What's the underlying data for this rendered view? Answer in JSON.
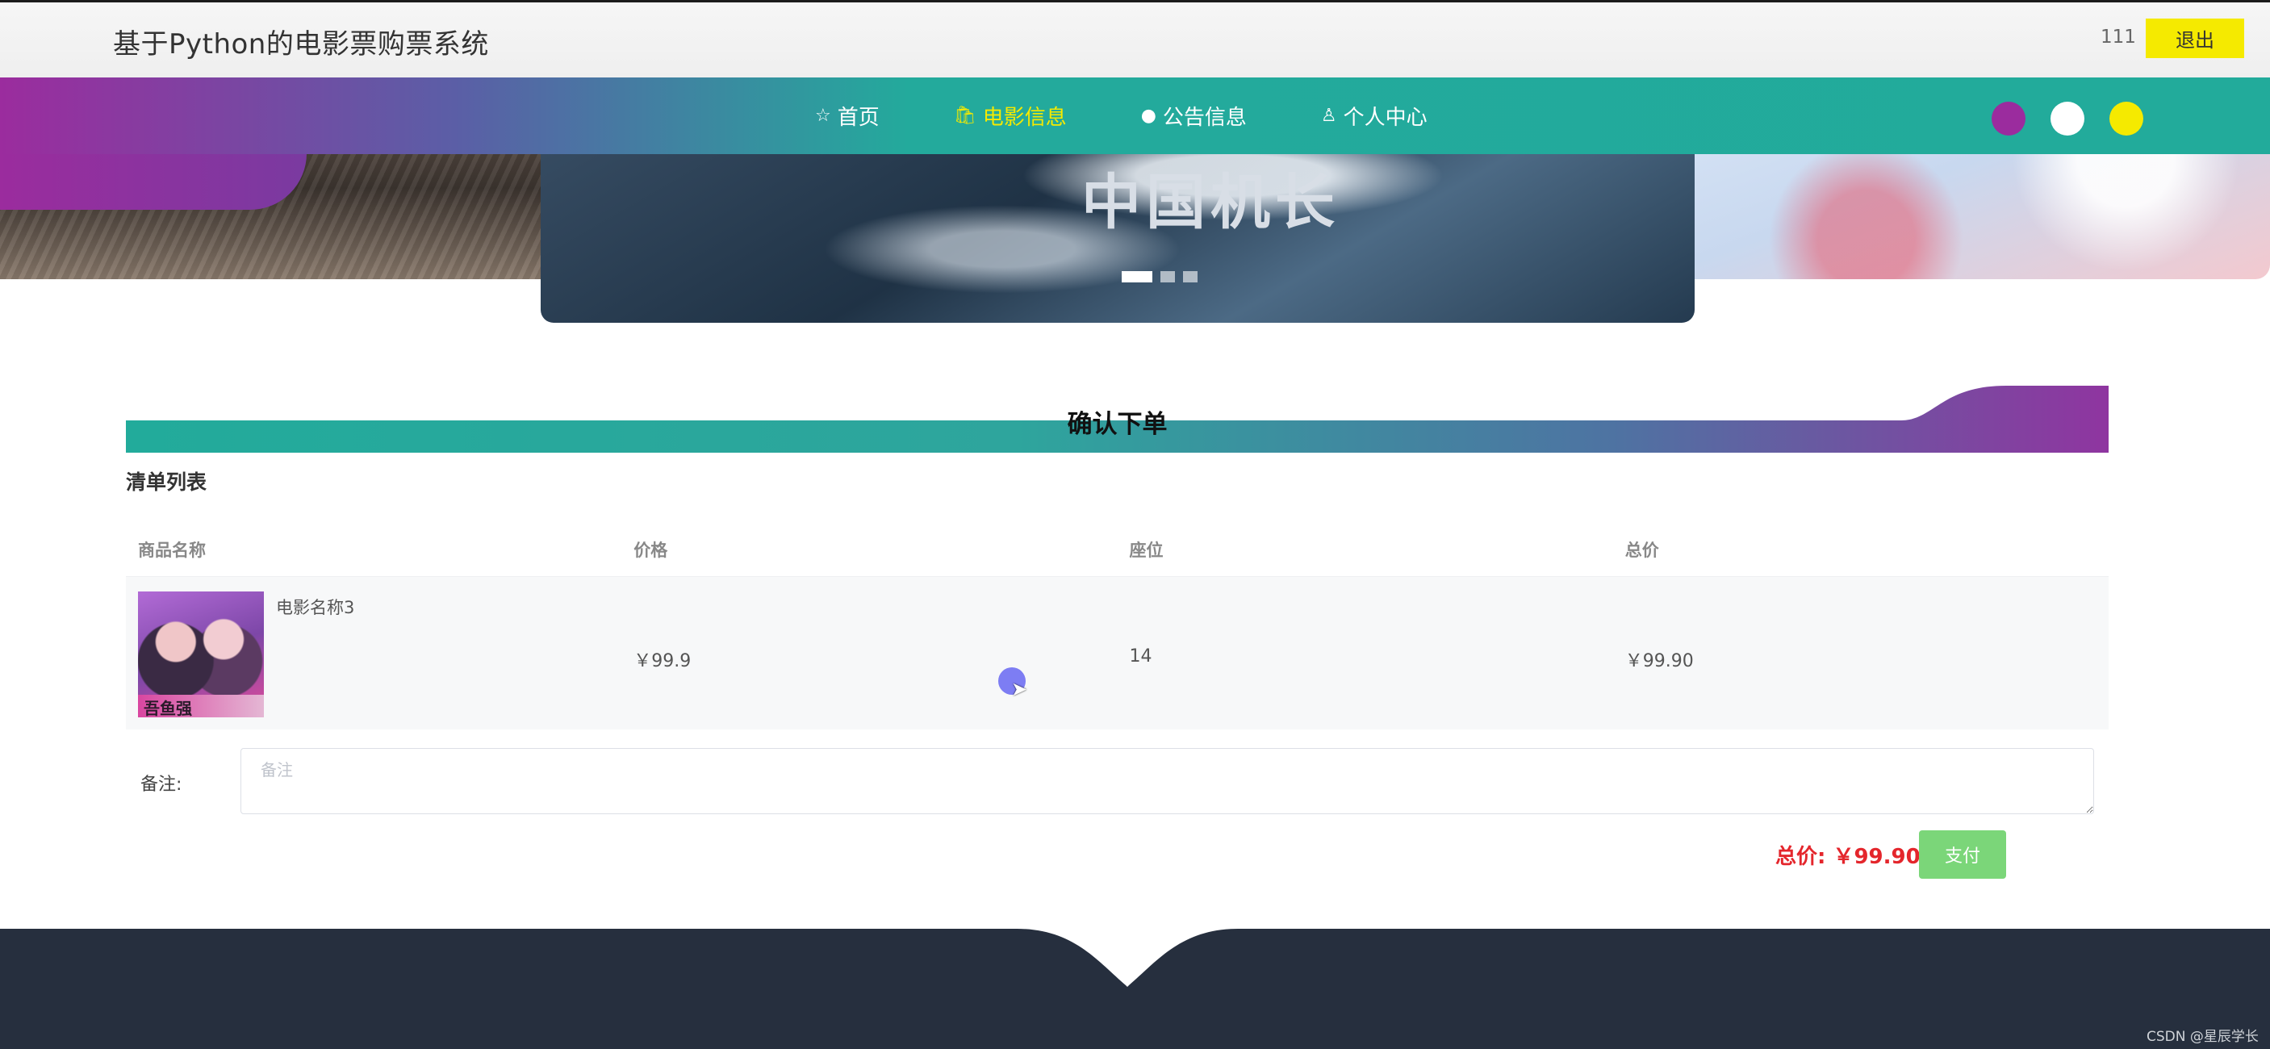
{
  "header": {
    "site_title": "基于Python的电影票购票系统",
    "username": "111",
    "logout_label": "退出"
  },
  "banner": {
    "caption": "中国机长",
    "slide_count": 3,
    "active_slide": 1
  },
  "nav": {
    "items": [
      {
        "label": "首页",
        "icon": "star-icon",
        "active": false
      },
      {
        "label": "电影信息",
        "icon": "bag-icon",
        "active": true
      },
      {
        "label": "公告信息",
        "icon": "info-icon",
        "active": false
      },
      {
        "label": "个人中心",
        "icon": "user-icon",
        "active": false
      }
    ],
    "theme_colors": [
      "#9b2c9e",
      "#ffffff",
      "#f5ea00"
    ]
  },
  "order": {
    "section_title": "确认下单",
    "list_title": "清单列表",
    "columns": [
      "商品名称",
      "价格",
      "座位",
      "总价"
    ],
    "rows": [
      {
        "name": "电影名称3",
        "price": "￥99.9",
        "seat": "14",
        "total": "￥99.90",
        "poster_text": "吾鱼强"
      }
    ],
    "remark_label": "备注:",
    "remark_placeholder": "备注",
    "remark_value": "",
    "total_text": "总价: ￥99.90",
    "pay_label": "支付"
  },
  "colors": {
    "accent": "#22ab9b",
    "brand_purple": "#9b2c9e",
    "logout_yellow": "#f5ea00",
    "total_red": "#e4262c",
    "pay_green": "#7bd679",
    "footer_dark": "#262f3e"
  },
  "watermark": "CSDN @星辰学长"
}
